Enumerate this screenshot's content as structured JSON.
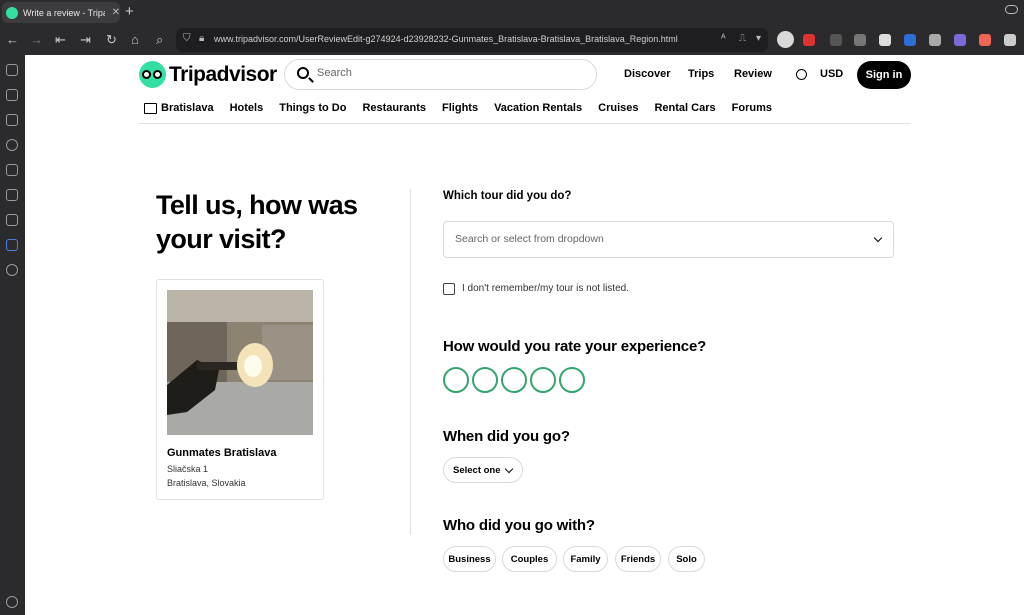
{
  "browser": {
    "tab_title": "Write a review - Tripadvisor",
    "url": "www.tripadvisor.com/UserReviewEdit-g274924-d23928232-Gunmates_Bratislava-Bratislava_Bratislava_Region.html"
  },
  "header": {
    "logo_text": "Tripadvisor",
    "search_placeholder": "Search",
    "nav": [
      "Discover",
      "Trips",
      "Review"
    ],
    "currency": "USD",
    "sign_in": "Sign in"
  },
  "subnav": {
    "location": "Bratislava",
    "items": [
      "Hotels",
      "Things to Do",
      "Restaurants",
      "Flights",
      "Vacation Rentals",
      "Cruises",
      "Rental Cars",
      "Forums"
    ]
  },
  "main": {
    "headline": "Tell us, how was your visit?",
    "card": {
      "name": "Gunmates Bratislava",
      "address_line1": "Sliačska 1",
      "address_line2": "Bratislava, Slovakia"
    }
  },
  "form": {
    "tour_question": "Which tour did you do?",
    "tour_placeholder": "Search or select from dropdown",
    "not_listed_label": "I don't remember/my tour is not listed.",
    "rating_question": "How would you rate your experience?",
    "rating_value": 0,
    "when_question": "When did you go?",
    "when_select": "Select one",
    "who_question": "Who did you go with?",
    "companions": [
      "Business",
      "Couples",
      "Family",
      "Friends",
      "Solo"
    ]
  },
  "colors": {
    "brand_green": "#34e0a1",
    "bubble_green": "#34a56f"
  }
}
